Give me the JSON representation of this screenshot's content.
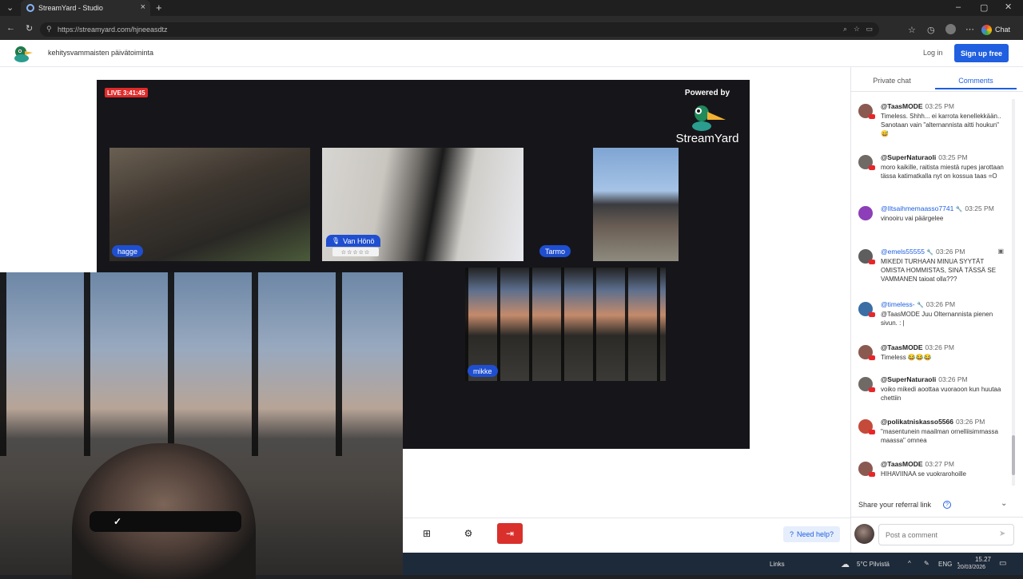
{
  "browser": {
    "tab_title": "StreamYard - Studio",
    "tab_close": "×",
    "new_tab": "+",
    "url": "https://streamyard.com/hjneeasdtz",
    "chat_label": "Chat"
  },
  "header": {
    "studio_title": "kehitysvammaisten päivätoiminta",
    "login": "Log in",
    "signup": "Sign up free"
  },
  "stage": {
    "live_badge": "LIVE 3:41:45",
    "powered_by": "Powered by",
    "brand": "StreamYard",
    "participants": {
      "hagge": "hagge",
      "van": "Van Hönö",
      "van_stars": "☆☆☆☆☆",
      "tarmo": "Tarmo",
      "mikke": "mikke"
    }
  },
  "controls": {
    "need_help": "Need help?"
  },
  "sidebar": {
    "tabs": [
      "Private chat",
      "Comments"
    ],
    "referral": "Share your referral link",
    "comment_placeholder": "Post a comment",
    "comments": [
      {
        "author": "@TaasMODE",
        "time": "03:25 PM",
        "text": "Timeless. Shhh... ei karrota kenellekkään.. Sanotaan vain \"alternannista aitti houkun\" 😅",
        "avatar_color": "#8a5a50",
        "blue": false
      },
      {
        "author": "@SuperNaturaoli",
        "time": "03:25 PM",
        "text": "moro kaikille, raitista miestä rupes jarottaan tässa katimatkalla nyt on kossua taas =O",
        "avatar_color": "#6f6a66",
        "blue": false
      },
      {
        "author": "@Iltsaihmemaasso7741",
        "time": "03:25 PM",
        "text": "vinooiru vai päärgelee",
        "avatar_color": "#8c3fb8",
        "blue": true
      },
      {
        "author": "@emels55555",
        "time": "03:26 PM",
        "text": "MIKEDI TURHAAN MINUA SYYTÄT OMISTA HOMMISTAS, SINÄ TÄSSÄ SE VAMMANEN taioat olla???",
        "avatar_color": "#5e5e5e",
        "blue": true
      },
      {
        "author": "@timeless-",
        "time": "03:26 PM",
        "text": "@TaasMODE Juu Olternannista pienen sivun. : |",
        "avatar_color": "#3a6ea5",
        "blue": true
      },
      {
        "author": "@TaasMODE",
        "time": "03:26 PM",
        "text": "Timeless 😂😂😂",
        "avatar_color": "#8a5a50",
        "blue": false
      },
      {
        "author": "@SuperNaturaoli",
        "time": "03:26 PM",
        "text": "voiko mikedi aoottaa vuoraoon kun huutaa chettiin",
        "avatar_color": "#6f6a66",
        "blue": false
      },
      {
        "author": "@polikatniskasso5566",
        "time": "03:26 PM",
        "text": "\"masentunein maailman ornelliisimmassa maassa\" omnea",
        "avatar_color": "#c44a3a",
        "blue": false
      },
      {
        "author": "@TaasMODE",
        "time": "03:27 PM",
        "text": "HIHAVIINAA se vuokrarohoille",
        "avatar_color": "#8a5a50",
        "blue": false
      }
    ]
  },
  "taskbar": {
    "links": "Links",
    "weather": "5°C Pilvistä",
    "lang": "ENG",
    "time": "15.27",
    "date": "20/03/2026"
  },
  "colors": {
    "accent": "#1f5fe0",
    "live": "#e02a2a",
    "leave": "#d9302c",
    "stage": "#16161a"
  }
}
